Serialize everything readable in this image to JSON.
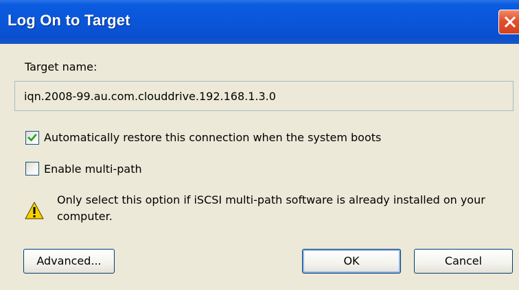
{
  "window": {
    "title": "Log On to Target",
    "close_icon": "close-icon"
  },
  "target": {
    "label": "Target name:",
    "value": "iqn.2008-99.au.com.clouddrive.192.168.1.3.0"
  },
  "options": {
    "auto_restore": {
      "label": "Automatically restore this connection when the system boots",
      "checked": true
    },
    "multi_path": {
      "label": "Enable multi-path",
      "checked": false
    }
  },
  "warning": {
    "icon": "warning-icon",
    "text": "Only select this option if iSCSI multi-path software is already installed on your computer."
  },
  "buttons": {
    "advanced": "Advanced...",
    "ok": "OK",
    "cancel": "Cancel"
  },
  "colors": {
    "titlebar": "#0a55d8",
    "dialog_face": "#ece9d8",
    "checkmark": "#21a121",
    "close_button": "#e1502d",
    "default_button_ring": "#8fb2e8",
    "warning": "#f5d000"
  }
}
